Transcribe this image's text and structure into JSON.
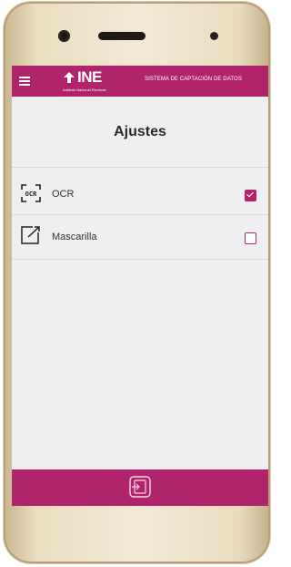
{
  "header": {
    "logo_text": "INE",
    "logo_subtitle": "Instituto Nacional Electoral",
    "app_title": "SISTEMA DE CAPTACIÓN DE DATOS"
  },
  "page": {
    "title": "Ajustes"
  },
  "settings": [
    {
      "label": "OCR",
      "icon": "ocr-icon",
      "checked": true
    },
    {
      "label": "Mascarilla",
      "icon": "mask-frame-icon",
      "checked": false
    }
  ],
  "colors": {
    "brand": "#b0246b",
    "screen_bg": "#efeff1",
    "phone_body": "#f3ead6"
  }
}
